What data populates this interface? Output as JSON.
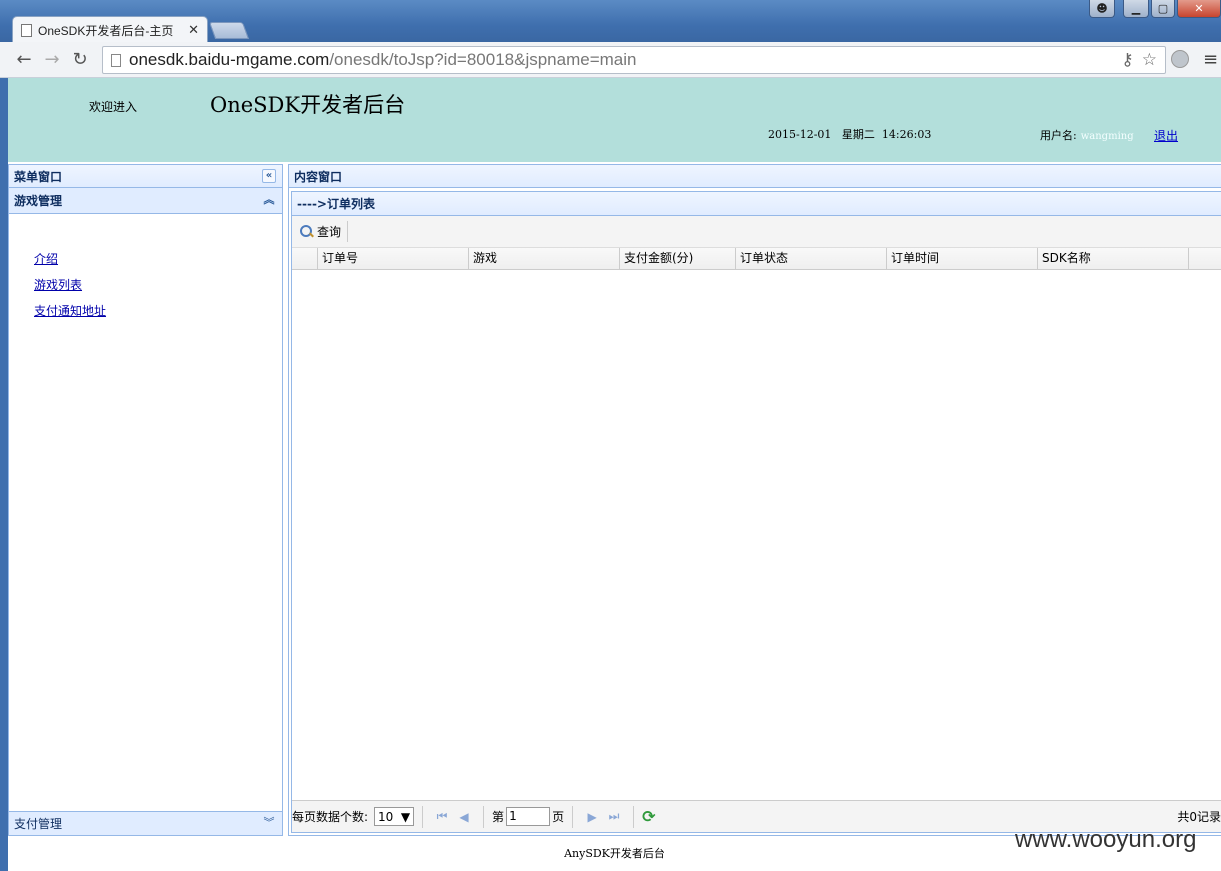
{
  "browser": {
    "tab_title": "OneSDK开发者后台-主页",
    "url_host": "onesdk.baidu-mgame.com",
    "url_path": "/onesdk/toJsp?id=80018&jspname=main"
  },
  "header": {
    "welcome": "欢迎进入",
    "title": "OneSDK开发者后台",
    "date": "2015-12-01",
    "weekday": "星期二",
    "time": "14:26:03",
    "user_label": "用户名:",
    "username": "wangming",
    "logout": "退出",
    "bg_color": "#b3dfdb"
  },
  "menu_panel": {
    "title": "菜单窗口",
    "sections": [
      {
        "label": "游戏管理",
        "expanded": true,
        "items": [
          "介绍",
          "游戏列表",
          "支付通知地址"
        ]
      },
      {
        "label": "支付管理",
        "expanded": false
      }
    ]
  },
  "content_panel": {
    "title": "内容窗口",
    "subtitle": "---->订单列表",
    "query_button": "查询",
    "columns": [
      "订单号",
      "游戏",
      "支付金额(分)",
      "订单状态",
      "订单时间",
      "SDK名称"
    ],
    "rows": []
  },
  "pager": {
    "page_size_label": "每页数据个数:",
    "page_size": "10",
    "page_prefix": "第",
    "page_value": "1",
    "page_suffix": "页",
    "total": "共0记录"
  },
  "footer": {
    "text": "AnySDK开发者后台",
    "watermark": "www.wooyun.org"
  }
}
